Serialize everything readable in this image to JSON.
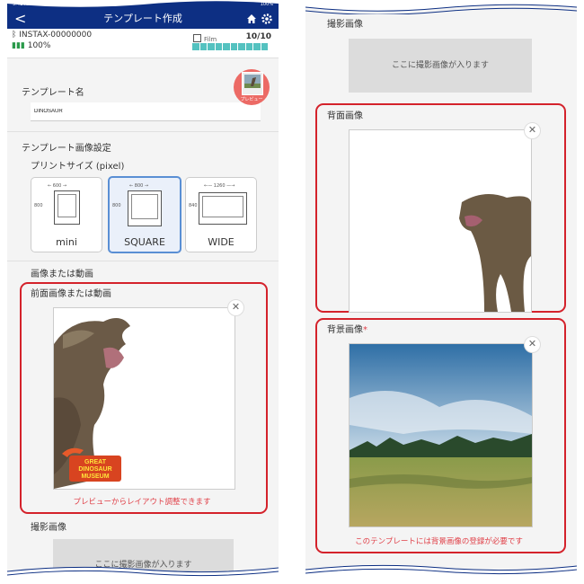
{
  "status": {
    "time": "9:41 AM",
    "date": "Tue Sep 14",
    "battery": "100%"
  },
  "nav": {
    "title": "テンプレート作成",
    "back": "<",
    "home_icon": "home-icon",
    "settings_icon": "gear-icon"
  },
  "device": {
    "name": "INSTAX-00000000",
    "battery": "100%",
    "film_label": "Film",
    "film_count": "10/10"
  },
  "template_name": {
    "label": "テンプレート名",
    "value": "DINOSAUR",
    "preview_label": "プレビュー"
  },
  "image_settings": {
    "label": "テンプレート画像設定",
    "print_size_label": "プリントサイズ (pixel)",
    "sizes": [
      {
        "name": "mini",
        "width": "600",
        "height": "800"
      },
      {
        "name": "SQUARE",
        "width": "800",
        "height": "800"
      },
      {
        "name": "WIDE",
        "width": "1260",
        "height": "840"
      }
    ],
    "selected_size": "SQUARE"
  },
  "image_or_video_label": "画像または動画",
  "front": {
    "label": "前面画像または動画",
    "note": "プレビューからレイアウト調整できます",
    "logo": [
      "GREAT",
      "DINOSAUR",
      "MUSEUM"
    ]
  },
  "capture": {
    "label": "撮影画像",
    "placeholder": "ここに撮影画像が入ります"
  },
  "back_image": {
    "label": "背面画像"
  },
  "background_image": {
    "label": "背景画像",
    "required_mark": "*",
    "note": "このテンプレートには背景画像の登録が必要です"
  },
  "colors": {
    "nav": "#0d2f83",
    "accent_red": "#d4222b",
    "film": "#54c2c0",
    "selected": "#5a8fd4"
  }
}
